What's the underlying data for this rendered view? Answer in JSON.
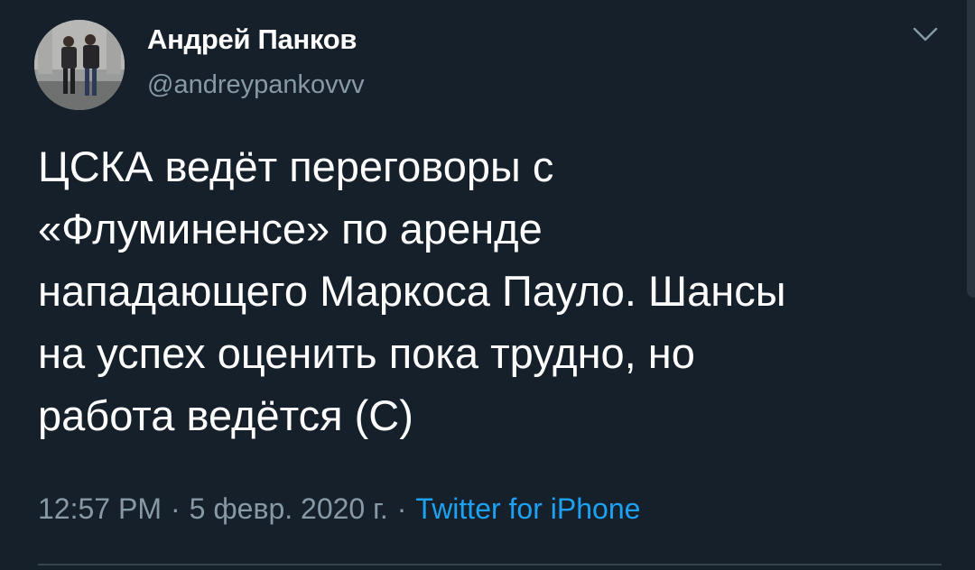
{
  "author": {
    "display_name": "Андрей Панков",
    "handle": "@andreypankovvv",
    "avatar_icon": "profile-photo"
  },
  "tweet": {
    "text": "ЦСКА ведёт переговоры с\n«Флуминенсе» по аренде\nнападающего Маркоса Пауло. Шансы\nна успех оценить пока трудно, но\nработа ведётся (С)",
    "time": "12:57 PM",
    "date": "5 февр. 2020 г.",
    "separator": "·",
    "source": "Twitter for iPhone"
  },
  "icons": {
    "menu_caret": "chevron-down-icon"
  },
  "colors": {
    "background": "#15202b",
    "primary_text": "#ffffff",
    "secondary_text": "#8899a6",
    "accent": "#1da1f2",
    "divider": "#38444d"
  }
}
